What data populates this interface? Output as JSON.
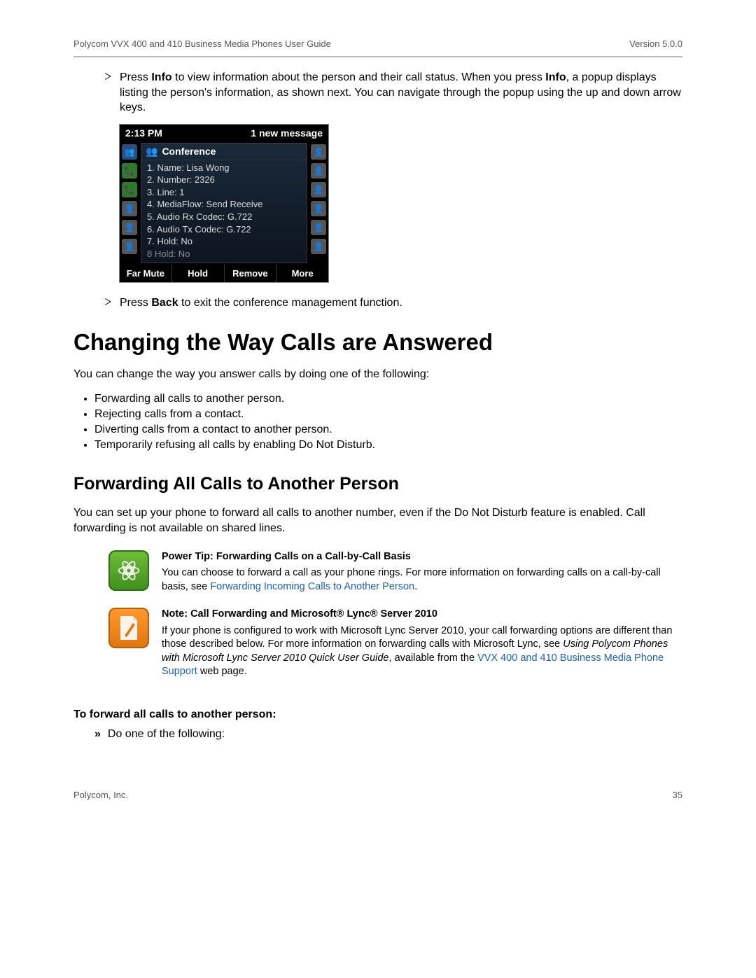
{
  "header": {
    "doc_title": "Polycom VVX 400 and 410 Business Media Phones User Guide",
    "version": "Version 5.0.0"
  },
  "bullet_info": {
    "pre": "Press ",
    "bold1": "Info",
    "mid": " to view information about the person and their call status. When you press ",
    "bold2": "Info",
    "post": ", a popup displays listing the person's information, as shown next. You can navigate through the popup using the up and down arrow keys."
  },
  "phone": {
    "time": "2:13 PM",
    "msg": "1 new message",
    "conf_label": "Conference",
    "items": [
      "1. Name: Lisa Wong",
      "2. Number: 2326",
      "3. Line: 1",
      "4. MediaFlow: Send Receive",
      "5. Audio Rx Codec: G.722",
      "6. Audio Tx Codec: G.722",
      "7. Hold: No",
      "8  Hold: No"
    ],
    "softkeys": [
      "Far Mute",
      "Hold",
      "Remove",
      "More"
    ]
  },
  "bullet_back": {
    "pre": "Press ",
    "bold": "Back",
    "post": " to exit the conference management function."
  },
  "heading_main": "Changing the Way Calls are Answered",
  "intro_para": "You can change the way you answer calls by doing one of the following:",
  "change_list": [
    "Forwarding all calls to another person.",
    "Rejecting calls from a contact.",
    "Diverting calls from a contact to another person.",
    "Temporarily refusing all calls by enabling Do Not Disturb."
  ],
  "heading_sub": "Forwarding All Calls to Another Person",
  "fwd_para": "You can set up your phone to forward all calls to another number, even if the Do Not Disturb feature is enabled. Call forwarding is not available on shared lines.",
  "tip": {
    "title": "Power Tip: Forwarding Calls on a Call-by-Call Basis",
    "body_pre": "You can choose to forward a call as your phone rings. For more information on forwarding calls on a call-by-call basis, see ",
    "link": "Forwarding Incoming Calls to Another Person",
    "body_post": "."
  },
  "note": {
    "title": "Note: Call Forwarding and Microsoft® Lync® Server 2010",
    "body_pre": "If your phone is configured to work with Microsoft Lync Server 2010, your call forwarding options are different than those described below. For more information on forwarding calls with Microsoft Lync, see ",
    "italic": "Using Polycom Phones with Microsoft Lync Server 2010 Quick User Guide",
    "body_mid": ", available from the ",
    "link": "VVX 400 and 410 Business Media Phone Support",
    "body_post": " web page."
  },
  "step_heading": "To forward all calls to another person:",
  "step_item": "Do one of the following:",
  "footer": {
    "company": "Polycom, Inc.",
    "page": "35"
  }
}
